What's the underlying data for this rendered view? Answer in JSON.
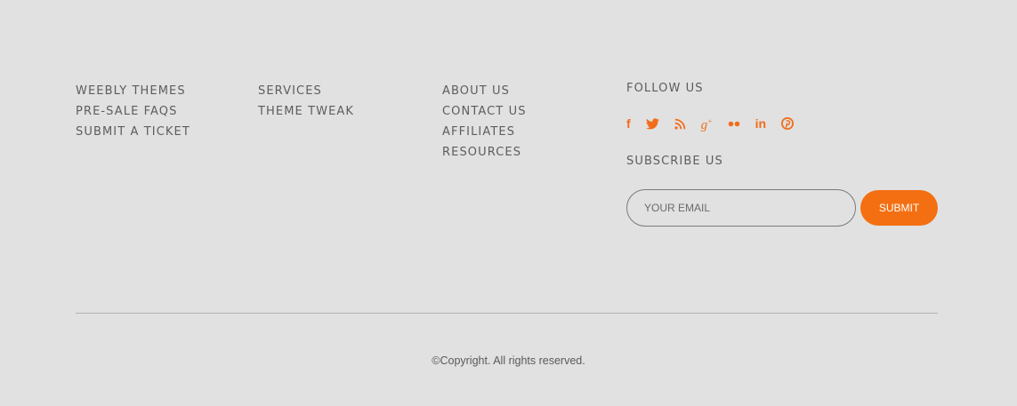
{
  "footer": {
    "col1": [
      "WEEBLY THEMES",
      "PRE-SALE FAQS",
      "SUBMIT A TICKET"
    ],
    "col2": [
      "SERVICES",
      "THEME TWEAK"
    ],
    "col3": [
      "ABOUT US",
      "CONTACT US",
      "AFFILIATES",
      "RESOURCES"
    ],
    "follow_heading": "FOLLOW US",
    "social_icons": [
      "facebook-icon",
      "twitter-icon",
      "rss-icon",
      "google-plus-icon",
      "flickr-icon",
      "linkedin-icon",
      "pinterest-icon"
    ],
    "subscribe_heading": "SUBSCRIBE US",
    "email_placeholder": "YOUR EMAIL",
    "submit_label": "SUBMIT",
    "copyright": "©Copyright. All rights reserved."
  },
  "colors": {
    "background": "#e1e1e1",
    "accent": "#f46f12",
    "text": "#5d5d5d"
  }
}
